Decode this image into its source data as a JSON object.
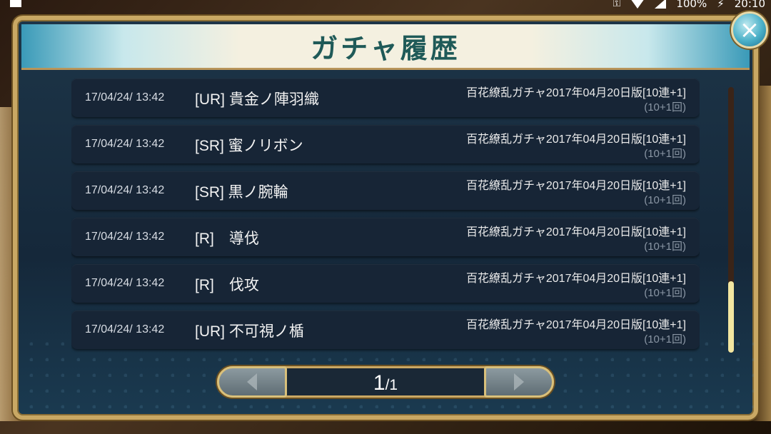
{
  "status_bar": {
    "battery": "100%",
    "time": "20:10",
    "icons": [
      "image-icon",
      "key-icon",
      "wifi-icon",
      "signal-icon",
      "charging-icon"
    ]
  },
  "dialog": {
    "title": "ガチャ履歴",
    "close_icon": "×"
  },
  "history": [
    {
      "date": "17/04/24/ 13:42",
      "card": "[UR] 貴金ノ陣羽織",
      "gacha": "百花繚乱ガチャ2017年04月20日版[10連+1]",
      "count": "(10+1回)"
    },
    {
      "date": "17/04/24/ 13:42",
      "card": "[SR] 蜜ノリボン",
      "gacha": "百花繚乱ガチャ2017年04月20日版[10連+1]",
      "count": "(10+1回)"
    },
    {
      "date": "17/04/24/ 13:42",
      "card": "[SR] 黒ノ腕輪",
      "gacha": "百花繚乱ガチャ2017年04月20日版[10連+1]",
      "count": "(10+1回)"
    },
    {
      "date": "17/04/24/ 13:42",
      "card": "[R]　導伐",
      "gacha": "百花繚乱ガチャ2017年04月20日版[10連+1]",
      "count": "(10+1回)"
    },
    {
      "date": "17/04/24/ 13:42",
      "card": "[R]　伐攻",
      "gacha": "百花繚乱ガチャ2017年04月20日版[10連+1]",
      "count": "(10+1回)"
    },
    {
      "date": "17/04/24/ 13:42",
      "card": "[UR] 不可視ノ楯",
      "gacha": "百花繚乱ガチャ2017年04月20日版[10連+1]",
      "count": "(10+1回)"
    }
  ],
  "pager": {
    "current": "1",
    "total": "/1"
  },
  "colors": {
    "frame_gold": "#c9a864",
    "panel_navy": "#15283a",
    "title_teal": "#1f5a58",
    "scroll_thumb": "#f2e6a0"
  }
}
